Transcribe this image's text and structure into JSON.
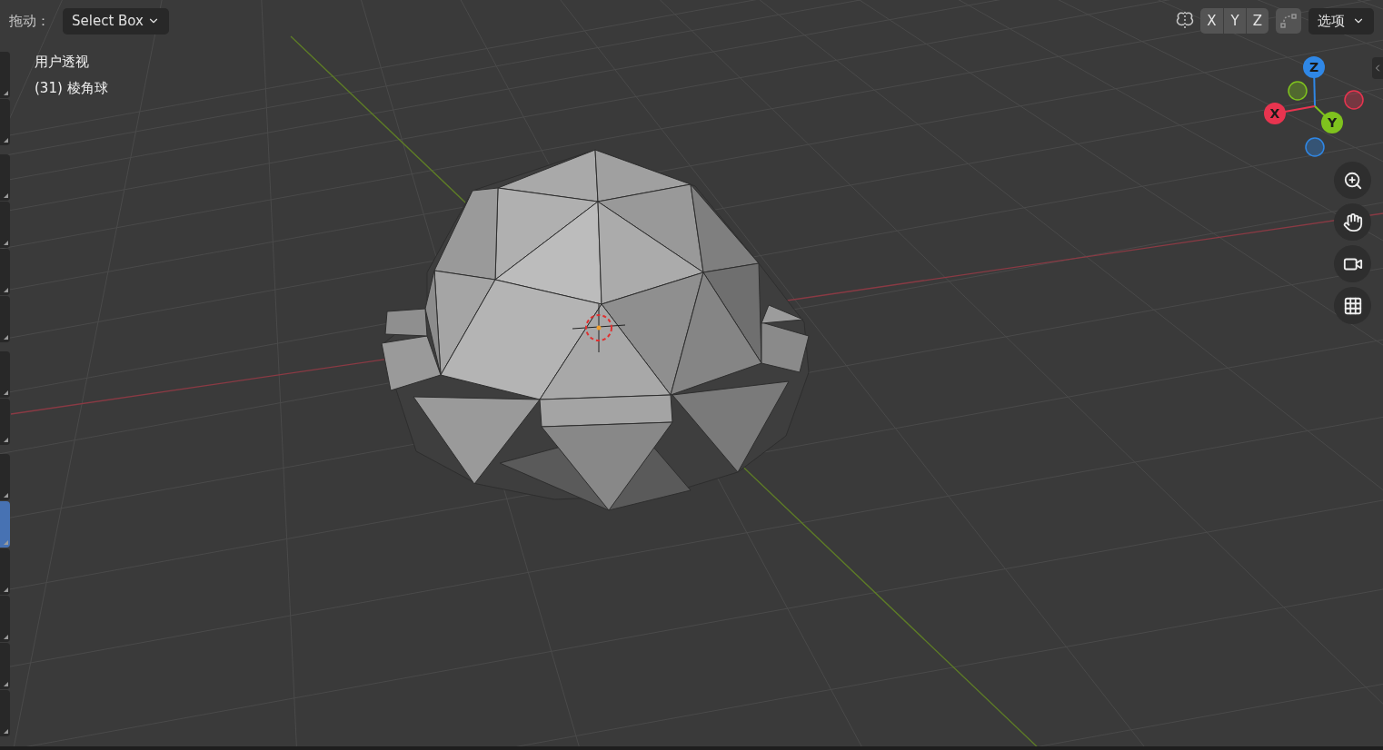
{
  "header": {
    "drag_label": "拖动：",
    "drag_mode": "Select Box",
    "mirror_axes": [
      {
        "label": "X"
      },
      {
        "label": "Y"
      },
      {
        "label": "Z"
      }
    ],
    "options": "选项"
  },
  "viewport": {
    "view_name": "用户透视",
    "object_info": "(31) 棱角球"
  },
  "gizmo": {
    "axes": [
      {
        "label": "Z",
        "color": "#2f87e6"
      },
      {
        "label": "X",
        "color": "#e8344f"
      },
      {
        "label": "Y",
        "color": "#7fc21e"
      }
    ]
  },
  "toolbar": {
    "groups": [
      {
        "tools": [
          {
            "selected": false
          },
          {
            "selected": false
          }
        ]
      },
      {
        "tools": [
          {
            "selected": false
          },
          {
            "selected": false
          },
          {
            "selected": false
          },
          {
            "selected": false
          }
        ]
      },
      {
        "tools": [
          {
            "selected": false
          },
          {
            "selected": false
          }
        ]
      },
      {
        "tools": [
          {
            "selected": false
          },
          {
            "selected": true
          },
          {
            "selected": false
          },
          {
            "selected": false
          },
          {
            "selected": false
          },
          {
            "selected": false
          }
        ]
      }
    ]
  }
}
